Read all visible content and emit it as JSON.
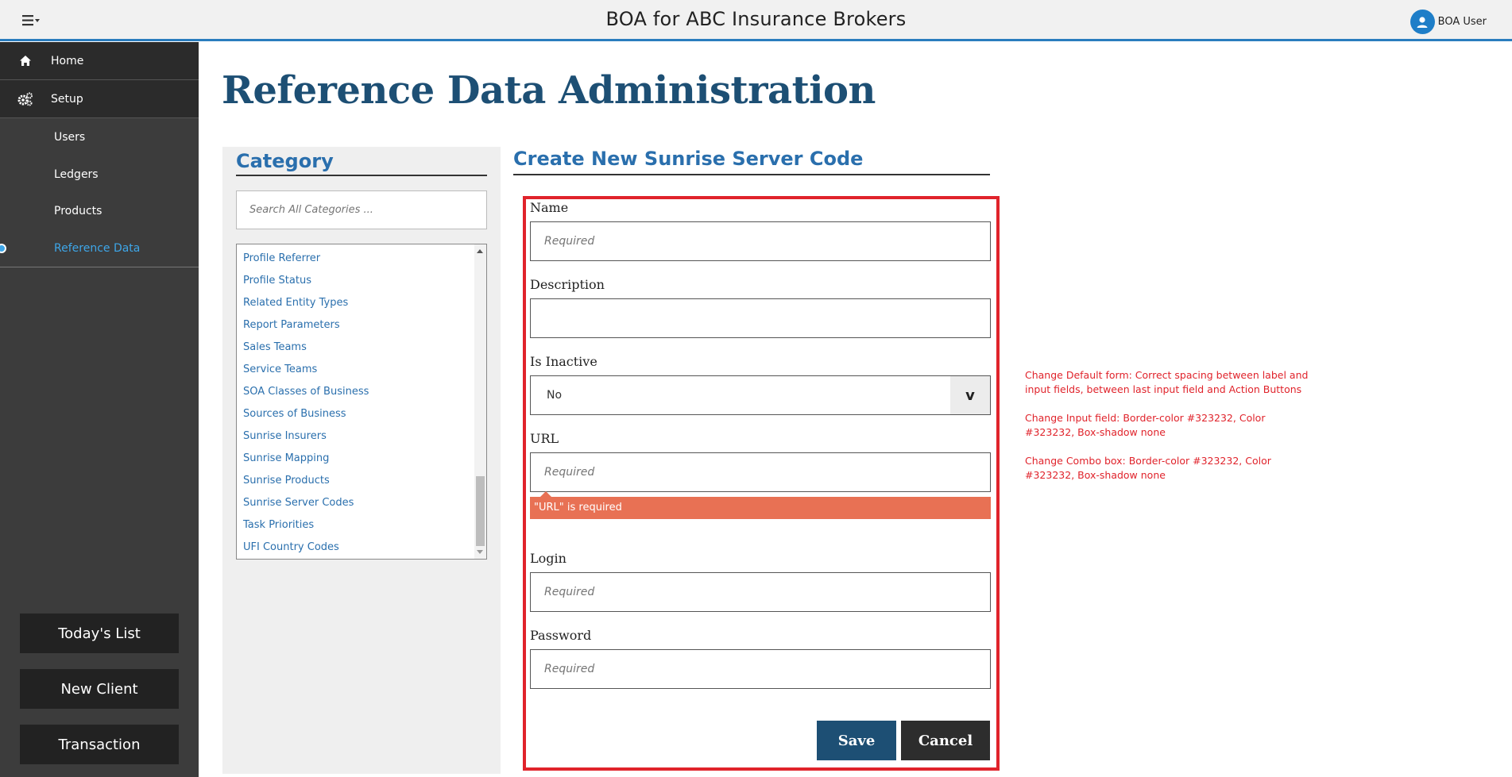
{
  "header": {
    "title": "BOA for ABC Insurance Brokers",
    "user_name": "BOA User"
  },
  "sidebar": {
    "main_items": [
      {
        "label": "Home",
        "icon": "home-icon"
      },
      {
        "label": "Setup",
        "icon": "gears-icon"
      }
    ],
    "sub_items": [
      {
        "label": "Users"
      },
      {
        "label": "Ledgers"
      },
      {
        "label": "Products"
      },
      {
        "label": "Reference Data"
      }
    ],
    "active_item": "Reference Data",
    "buttons": [
      "Today's List",
      "New Client",
      "Transaction"
    ]
  },
  "page": {
    "title": "Reference Data Administration"
  },
  "category": {
    "title": "Category",
    "search_placeholder": "Search All Categories ...",
    "items": [
      "Profile Referrer",
      "Profile Status",
      "Related Entity Types",
      "Report Parameters",
      "Sales Teams",
      "Service Teams",
      "SOA Classes of Business",
      "Sources of Business",
      "Sunrise Insurers",
      "Sunrise Mapping",
      "Sunrise Products",
      "Sunrise Server Codes",
      "Task Priorities",
      "UFI Country Codes"
    ]
  },
  "form": {
    "title": "Create New Sunrise Server Code",
    "name_label": "Name",
    "name_placeholder": "Required",
    "description_label": "Description",
    "description_value": "",
    "inactive_label": "Is Inactive",
    "inactive_value": "No",
    "inactive_arrow": "v",
    "url_label": "URL",
    "url_placeholder": "Required",
    "url_error": "\"URL\" is required",
    "login_label": "Login",
    "login_placeholder": "Required",
    "password_label": "Password",
    "password_placeholder": "Required",
    "save_label": "Save",
    "cancel_label": "Cancel"
  },
  "notes": [
    "Change Default form: Correct spacing between label and input fields, between last input field and Action Buttons",
    "Change Input field: Border-color #323232, Color #323232, Box-shadow none",
    "Change Combo box: Border-color #323232, Color #323232, Box-shadow none"
  ],
  "colors": {
    "accent_blue": "#2a7dbe",
    "title_blue": "#1d4f74",
    "sidebar_bg": "#3c3c3c",
    "annotation_red": "#e0232b",
    "error_bg": "#e87154"
  }
}
